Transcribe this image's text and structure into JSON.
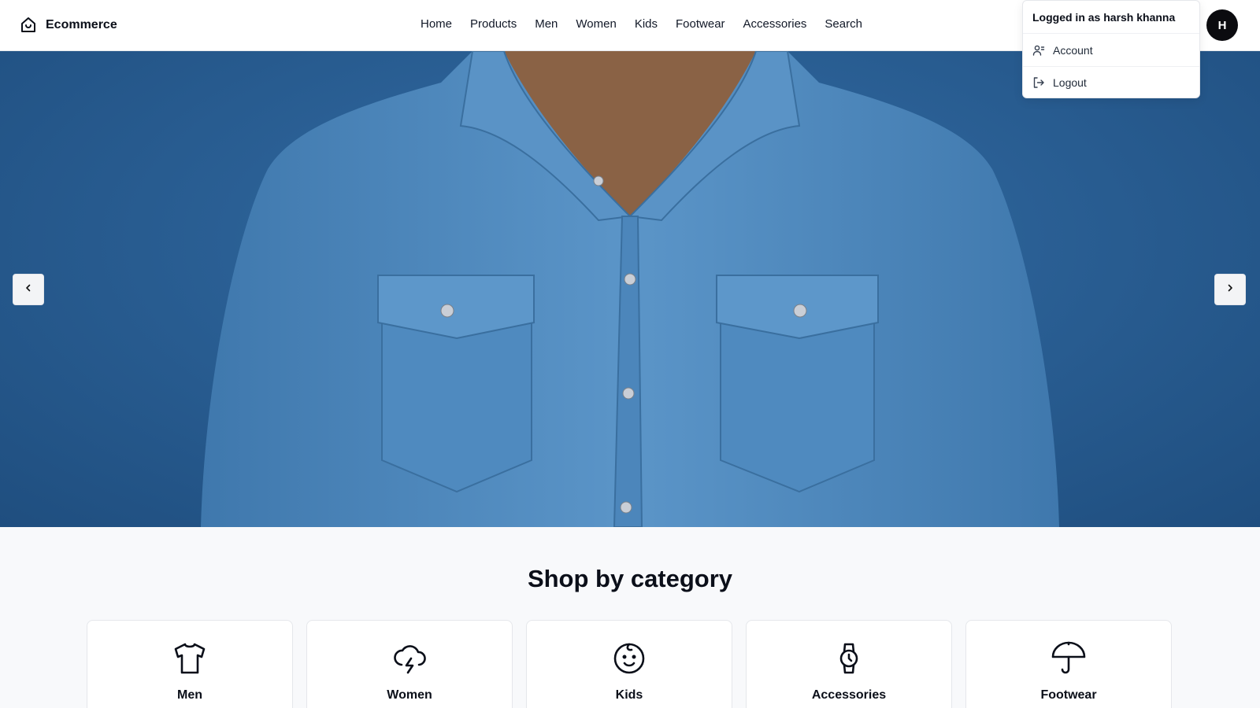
{
  "header": {
    "brand": "Ecommerce",
    "nav": [
      "Home",
      "Products",
      "Men",
      "Women",
      "Kids",
      "Footwear",
      "Accessories",
      "Search"
    ],
    "avatar_initial": "H"
  },
  "user_menu": {
    "logged_in_text": "Logged in as harsh khanna",
    "items": [
      {
        "label": "Account",
        "icon": "user-icon"
      },
      {
        "label": "Logout",
        "icon": "logout-icon"
      }
    ]
  },
  "hero": {
    "prev_icon": "chevron-left-icon",
    "next_icon": "chevron-right-icon",
    "image": "denim-shirt-banner"
  },
  "categories": {
    "title": "Shop by category",
    "items": [
      {
        "label": "Men",
        "icon": "shirt-icon"
      },
      {
        "label": "Women",
        "icon": "cloud-lightning-icon"
      },
      {
        "label": "Kids",
        "icon": "baby-icon"
      },
      {
        "label": "Accessories",
        "icon": "watch-icon"
      },
      {
        "label": "Footwear",
        "icon": "umbrella-icon"
      }
    ]
  },
  "colors": {
    "hero_bg": "#2a5f94",
    "denim": "#4f87bd",
    "avatar_bg": "#0b0b0f"
  }
}
